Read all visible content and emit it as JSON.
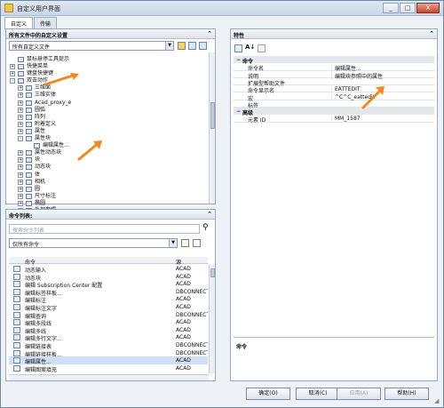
{
  "window": {
    "title": "自定义用户界面",
    "controls": [
      "_",
      "□",
      "X"
    ]
  },
  "tabs": [
    "自定义",
    "传输"
  ],
  "top_left_pane": {
    "header": "所有文件中的自定义设置",
    "dropdown": "所有自定义文件",
    "tree": [
      {
        "label": "鼠标悬停工具提示",
        "indent": 1,
        "node": ""
      },
      {
        "label": "快捷菜单",
        "indent": 1,
        "node": "+"
      },
      {
        "label": "键盘快捷键",
        "indent": 1,
        "node": "+"
      },
      {
        "label": "双击动作",
        "indent": 1,
        "node": "-"
      },
      {
        "label": "三维面",
        "indent": 2,
        "node": "+"
      },
      {
        "label": "三维实体",
        "indent": 2,
        "node": "+"
      },
      {
        "label": "Acad_proxy_e",
        "indent": 2,
        "node": "+"
      },
      {
        "label": "圆弧",
        "indent": 2,
        "node": "+"
      },
      {
        "label": "阵列",
        "indent": 2,
        "node": "+"
      },
      {
        "label": "附着定义",
        "indent": 2,
        "node": "+"
      },
      {
        "label": "属性",
        "indent": 2,
        "node": "+"
      },
      {
        "label": "属性块",
        "indent": 2,
        "node": "-"
      },
      {
        "label": "编辑属性...",
        "indent": 3,
        "node": ""
      },
      {
        "label": "属性动态块",
        "indent": 2,
        "node": "+"
      },
      {
        "label": "块",
        "indent": 2,
        "node": "+"
      },
      {
        "label": "动态块",
        "indent": 2,
        "node": "+"
      },
      {
        "label": "体",
        "indent": 2,
        "node": "+"
      },
      {
        "label": "相机",
        "indent": 2,
        "node": "+"
      },
      {
        "label": "圆",
        "indent": 2,
        "node": "+"
      },
      {
        "label": "尺寸标注",
        "indent": 2,
        "node": "+"
      },
      {
        "label": "椭圆",
        "indent": 2,
        "node": "+"
      },
      {
        "label": "外部参照",
        "indent": 2,
        "node": "+"
      },
      {
        "label": "图案填充",
        "indent": 2,
        "node": "+"
      }
    ]
  },
  "bottom_left_pane": {
    "header": "命令列表:",
    "search_placeholder": "搜索命令列表",
    "filter": "仅所有命令",
    "columns": [
      "命令",
      "源"
    ],
    "commands": [
      {
        "name": "动态输入",
        "source": "ACAD"
      },
      {
        "name": "动态块",
        "source": "ACAD"
      },
      {
        "name": "编辑 Subscription Center 配置",
        "source": "ACAD"
      },
      {
        "name": "编辑标签样板...",
        "source": "DBCONNECT"
      },
      {
        "name": "编辑标注",
        "source": "ACAD"
      },
      {
        "name": "编辑标注文字",
        "source": "ACAD"
      },
      {
        "name": "编辑查询",
        "source": "DBCONNECT"
      },
      {
        "name": "编辑多段线",
        "source": "ACAD"
      },
      {
        "name": "编辑多线",
        "source": "ACAD"
      },
      {
        "name": "编辑多行文字...",
        "source": "ACAD"
      },
      {
        "name": "编辑链接表",
        "source": "DBCONNECT"
      },
      {
        "name": "编辑链接样板...",
        "source": "DBCONNECT"
      },
      {
        "name": "编辑属性...",
        "source": "ACAD"
      },
      {
        "name": "编辑图案填充",
        "source": "ACAD"
      }
    ]
  },
  "right_pane": {
    "header": "特性",
    "categories": [
      {
        "title": "命令",
        "rows": [
          {
            "key": "命令名",
            "value": "编辑属性..."
          },
          {
            "key": "说明",
            "value": "编辑块参照中的属性"
          },
          {
            "key": "扩展型帮助文件",
            "value": ""
          },
          {
            "key": "命令显示名",
            "value": "EATTEDIT"
          },
          {
            "key": "宏",
            "value": "^C^C_eattedit"
          },
          {
            "key": "标签",
            "value": ""
          }
        ]
      },
      {
        "title": "高级",
        "rows": [
          {
            "key": "元素 ID",
            "value": "MM_1587"
          }
        ]
      }
    ],
    "description_label": "命令"
  },
  "buttons": {
    "ok": "确定(O)",
    "cancel": "取消(C)",
    "apply": "应用(A)",
    "help": "帮助(H)"
  },
  "colors": {
    "accent_arrow": "#f08a1c"
  }
}
